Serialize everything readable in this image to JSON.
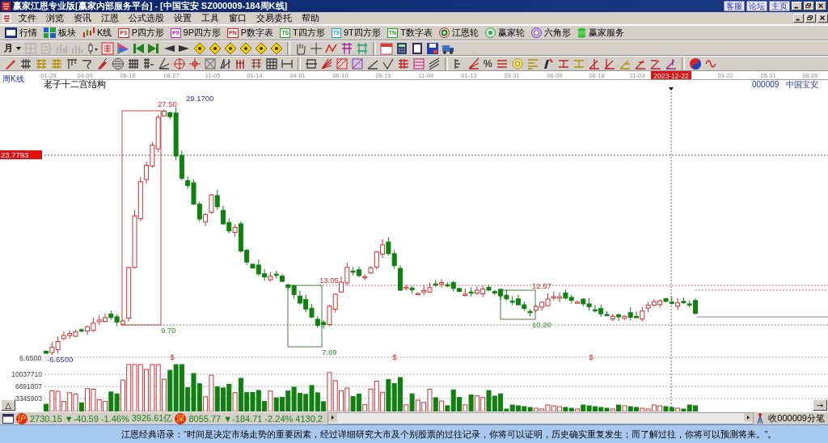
{
  "window": {
    "title": "赢家江恩专业版[赢家内部服务平台] - [中国宝安    SZ000009-184周K线]",
    "links": [
      "客服",
      "论坛",
      "主页"
    ]
  },
  "menu": [
    "文件",
    "浏览",
    "资讯",
    "江恩",
    "公式选股",
    "设置",
    "工具",
    "窗口",
    "交易委托",
    "帮助"
  ],
  "toolbar": [
    {
      "label": "行情",
      "kind": "screen"
    },
    {
      "label": "板块",
      "kind": "blocks"
    },
    {
      "label": "K线",
      "kind": "candles"
    },
    {
      "label": "P四方形",
      "kind": "badge",
      "badge": "PS",
      "color": "#d02020"
    },
    {
      "label": "9P四方形",
      "kind": "badge",
      "badge": "P9",
      "color": "#c020c0"
    },
    {
      "label": "P数字表",
      "kind": "badge",
      "badge": "PN",
      "color": "#d02020"
    },
    {
      "label": "T四方形",
      "kind": "badge",
      "badge": "TS",
      "color": "#20a020"
    },
    {
      "label": "9T四方形",
      "kind": "badge",
      "badge": "T9",
      "color": "#20a0c0"
    },
    {
      "label": "T数字表",
      "kind": "badge",
      "badge": "TN",
      "color": "#20a020"
    },
    {
      "label": "江恩轮",
      "kind": "wheel"
    },
    {
      "label": "赢家轮",
      "kind": "wheel2"
    },
    {
      "label": "六角形",
      "kind": "hexagon"
    },
    {
      "label": "赢家服务",
      "kind": "dollar"
    }
  ],
  "period_selector": "月",
  "drawing_tools": {
    "percent": "%"
  },
  "chart": {
    "period_label": "周K线",
    "title": "老子十二宫结构",
    "code": "000009",
    "name": "中国宝安",
    "dates": [
      {
        "label": "01-29",
        "selected": false
      },
      {
        "label": "04-09",
        "selected": false
      },
      {
        "label": "06-18",
        "selected": false
      },
      {
        "label": "08-27",
        "selected": false
      },
      {
        "label": "11-05",
        "selected": false
      },
      {
        "label": "01-14",
        "selected": false
      },
      {
        "label": "04-01",
        "selected": false
      },
      {
        "label": "06-10",
        "selected": false
      },
      {
        "label": "08-19",
        "selected": false
      },
      {
        "label": "11-04",
        "selected": false
      },
      {
        "label": "01-13",
        "selected": false
      },
      {
        "label": "03-31",
        "selected": false
      },
      {
        "label": "06-09",
        "selected": false
      },
      {
        "label": "08-18",
        "selected": false
      },
      {
        "label": "11-03",
        "selected": false
      },
      {
        "label": "2023-12-22",
        "selected": true
      },
      {
        "label": "03-22",
        "selected": false
      },
      {
        "label": "05-31",
        "selected": false
      },
      {
        "label": "08-09",
        "selected": false
      }
    ],
    "cursor_price": "23.7793",
    "axis_low": "6.6500",
    "price_labels": [
      {
        "text": "27.50",
        "kind": "high"
      },
      {
        "text": "29.1700",
        "kind": "extreme"
      },
      {
        "text": "9.70",
        "kind": "low"
      },
      {
        "text": "13.05",
        "kind": "high"
      },
      {
        "text": "7.89",
        "kind": "low"
      },
      {
        "text": "12.57",
        "kind": "high"
      },
      {
        "text": "10.20",
        "kind": "low"
      },
      {
        "text": "-6.6500",
        "kind": "extreme"
      }
    ],
    "dividend_marks": [
      "$",
      "$",
      "$"
    ],
    "volume_ticks": [
      "10037710",
      "6691807",
      "3345903"
    ],
    "collapse_button": "△",
    "scroll_button": "→"
  },
  "status_bar": {
    "indices": [
      {
        "badge": "沪",
        "value": "2730.15",
        "change": "▼-40.59",
        "percent": "-1.46%",
        "amount": "3926.61亿"
      },
      {
        "badge": "深",
        "value": "8055.77",
        "change": "▼-184.71",
        "percent": "-2.24%",
        "amount": "4130.2"
      }
    ],
    "ticker": "收000009分笔"
  },
  "quote": "江恩经典语录：“时间是决定市场走势的重要因素，经过详细研究大市及个别股票的过往记录，你将可以证明，历史确实重复发生；而了解过往，你将可以预测将来。”。"
}
